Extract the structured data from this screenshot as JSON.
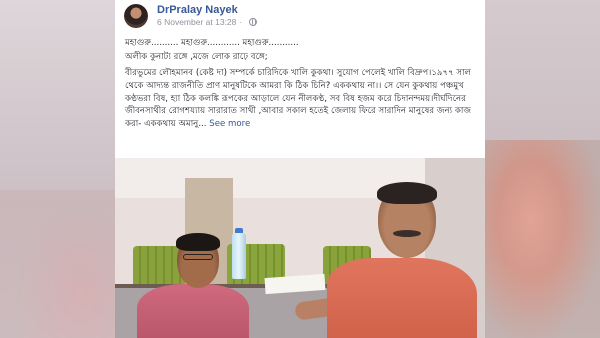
{
  "post": {
    "author": "DrPralay Nayek",
    "date": "6 November at 13:28",
    "separator": "·",
    "line1": "মহাগুরু.......... মহাগুরু............ মহাগুরু...........",
    "line2": "অলীক কুনাট্য রঙ্গে ,মজে লোক রাঢ়ে বঙ্গে;",
    "body": "বীরভুমের লৌহমানব (কেষ্ট দা) সম্পর্কে চারিদিকে খালি কুকথা। সুযোগ পেলেই খালি বিদ্রুপ।১৯৭৭ সাল থেকে আদ্যন্ত রাজনীতি প্রাণ মানুষটিকে আমরা কি ঠিক চিনি? এককথায় না।। সে যেন কুকথায় পঞ্চমুখ কণ্ঠভরা বিষ, হ্যা ঠিক কলঙ্কি রূপকের আড়ালে যেন নীলকণ্ঠ, সব বিষ হজম করে চিদানন্দময়।দীর্ঘদিনের জীবনসাথীর রোগশয্যায় সারারাত সাথী ,আবার সকাল হতেই জেলায় ফিরে সারাদিন মানুষের জন্য কাজ করা- এককথায় অমানু...",
    "see_more": "See more"
  },
  "icons": {
    "privacy": "globe-icon"
  },
  "colors": {
    "link": "#385898",
    "meta": "#90949c",
    "text": "#1d2129"
  }
}
